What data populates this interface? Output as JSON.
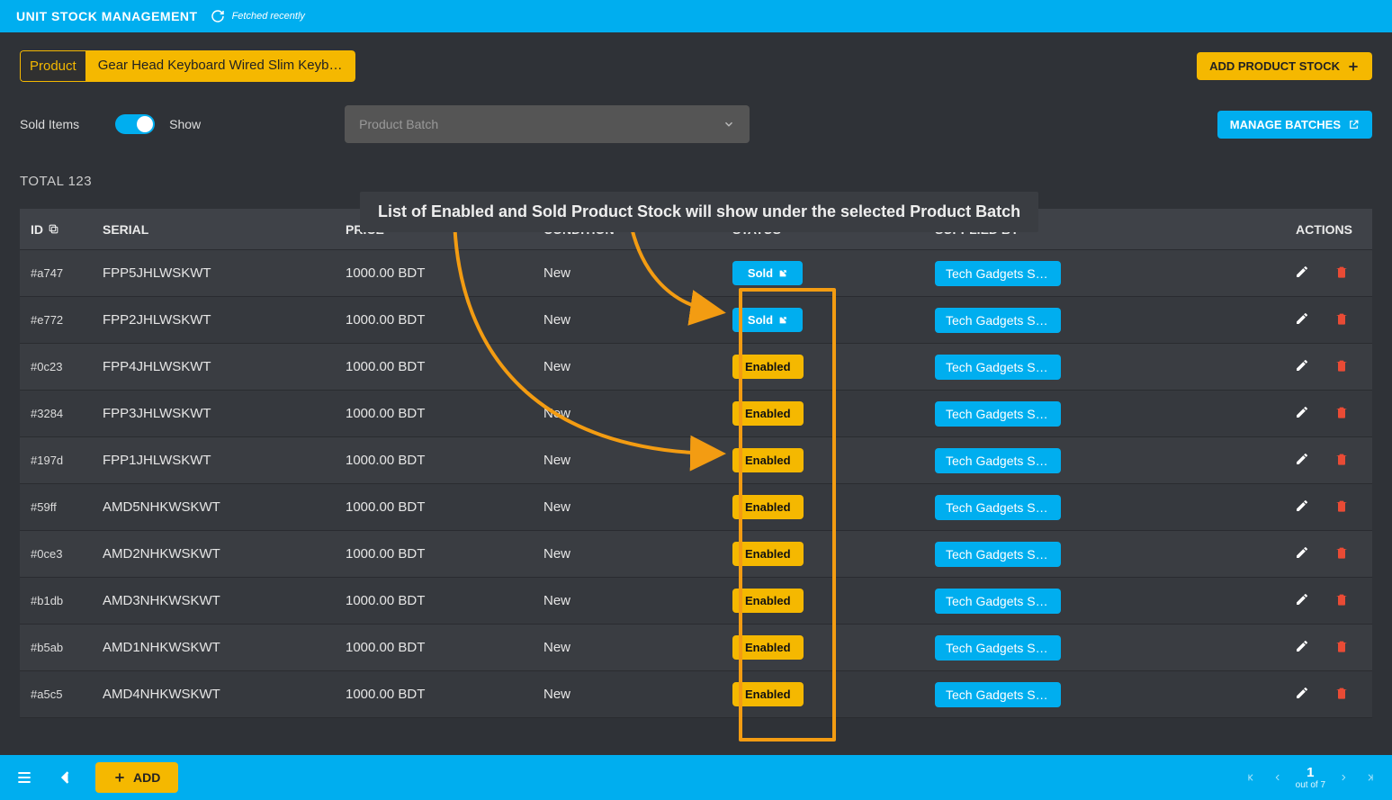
{
  "topbar": {
    "title": "UNIT STOCK MANAGEMENT",
    "fetched": "Fetched recently"
  },
  "product_pill": {
    "label": "Product",
    "value": "Gear Head Keyboard Wired Slim Keyboard ..."
  },
  "buttons": {
    "add_stock": "ADD PRODUCT STOCK",
    "manage_batches": "MANAGE BATCHES",
    "add_footer": "ADD"
  },
  "filters": {
    "sold_items_label": "Sold Items",
    "show_label": "Show",
    "batch_placeholder": "Product Batch"
  },
  "callout": "List of Enabled and Sold Product Stock will show under the selected Product Batch",
  "total": "TOTAL 123",
  "columns": {
    "id": "ID",
    "serial": "SERIAL",
    "price": "PRICE",
    "condition": "CONDITION",
    "status": "STATUS",
    "supplied": "SUPPLIED BY",
    "actions": "ACTIONS"
  },
  "supplier_display": "Tech Gadgets Su…",
  "status_display": {
    "sold": "Sold",
    "enabled": "Enabled"
  },
  "rows": [
    {
      "id": "#a747",
      "serial": "FPP5JHLWSKWT",
      "price": "1000.00 BDT",
      "condition": "New",
      "status": "sold"
    },
    {
      "id": "#e772",
      "serial": "FPP2JHLWSKWT",
      "price": "1000.00 BDT",
      "condition": "New",
      "status": "sold"
    },
    {
      "id": "#0c23",
      "serial": "FPP4JHLWSKWT",
      "price": "1000.00 BDT",
      "condition": "New",
      "status": "enabled"
    },
    {
      "id": "#3284",
      "serial": "FPP3JHLWSKWT",
      "price": "1000.00 BDT",
      "condition": "New",
      "status": "enabled"
    },
    {
      "id": "#197d",
      "serial": "FPP1JHLWSKWT",
      "price": "1000.00 BDT",
      "condition": "New",
      "status": "enabled"
    },
    {
      "id": "#59ff",
      "serial": "AMD5NHKWSKWT",
      "price": "1000.00 BDT",
      "condition": "New",
      "status": "enabled"
    },
    {
      "id": "#0ce3",
      "serial": "AMD2NHKWSKWT",
      "price": "1000.00 BDT",
      "condition": "New",
      "status": "enabled"
    },
    {
      "id": "#b1db",
      "serial": "AMD3NHKWSKWT",
      "price": "1000.00 BDT",
      "condition": "New",
      "status": "enabled"
    },
    {
      "id": "#b5ab",
      "serial": "AMD1NHKWSKWT",
      "price": "1000.00 BDT",
      "condition": "New",
      "status": "enabled"
    },
    {
      "id": "#a5c5",
      "serial": "AMD4NHKWSKWT",
      "price": "1000.00 BDT",
      "condition": "New",
      "status": "enabled"
    }
  ],
  "pager": {
    "page": "1",
    "outof": "out of 7"
  }
}
